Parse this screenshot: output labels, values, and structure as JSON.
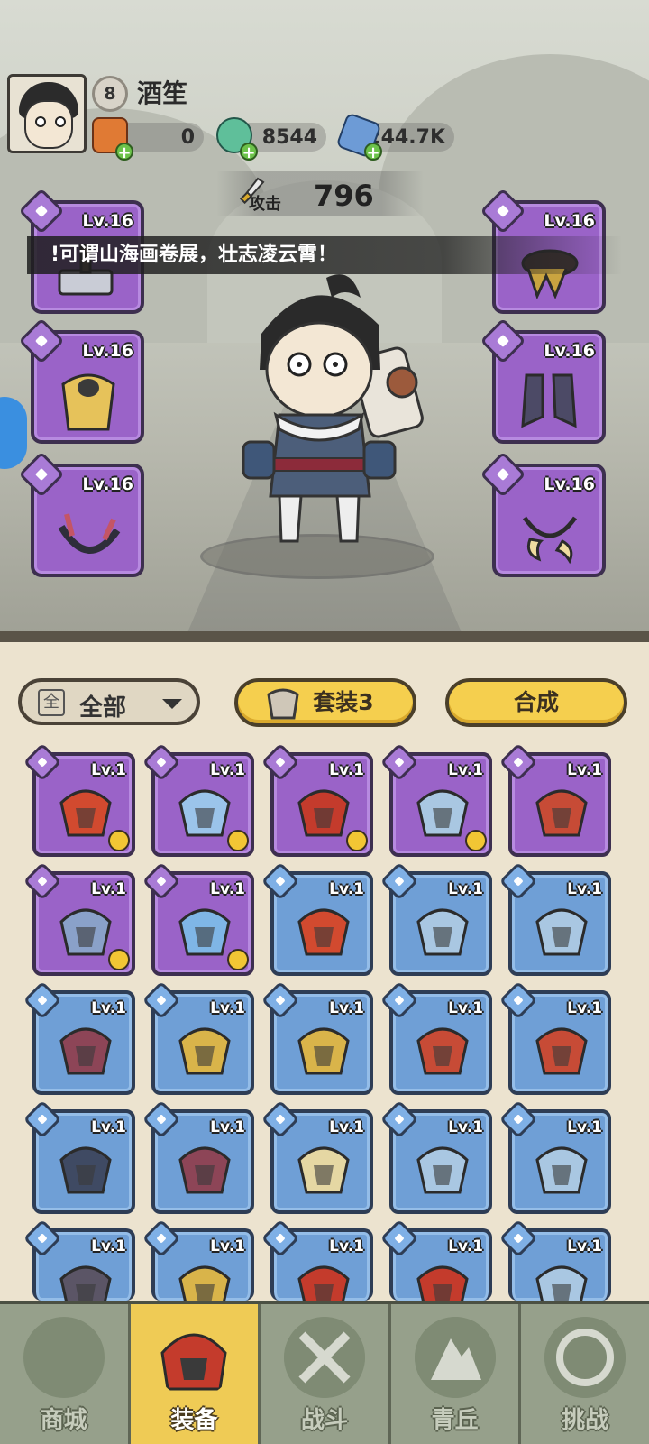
{
  "player": {
    "level": "8",
    "name": "酒笙"
  },
  "resources": [
    {
      "name": "scroll",
      "value": "0"
    },
    {
      "name": "jade",
      "value": "8544"
    },
    {
      "name": "crystal",
      "value": "244.7K"
    }
  ],
  "attack": {
    "label": "攻击",
    "value": "796"
  },
  "banner_text": "!可谓山海画卷展，壮志凌云霄！",
  "equipped": [
    {
      "slot": "weapon",
      "level": "Lv.16"
    },
    {
      "slot": "armor",
      "level": "Lv.16"
    },
    {
      "slot": "necklace",
      "level": "Lv.16"
    },
    {
      "slot": "belt",
      "level": "Lv.16"
    },
    {
      "slot": "boots",
      "level": "Lv.16"
    },
    {
      "slot": "ring",
      "level": "Lv.16"
    }
  ],
  "toolbar": {
    "filter_icon": "全",
    "filter_label": "全部",
    "set_label": "套装3",
    "merge_label": "合成"
  },
  "inventory": [
    {
      "rarity": "purple",
      "level": "Lv.1",
      "badge": true,
      "color": "#d24a2f"
    },
    {
      "rarity": "purple",
      "level": "Lv.1",
      "badge": true,
      "color": "#9bc4ea"
    },
    {
      "rarity": "purple",
      "level": "Lv.1",
      "badge": true,
      "color": "#c43b2c"
    },
    {
      "rarity": "purple",
      "level": "Lv.1",
      "badge": true,
      "color": "#a9c7e2"
    },
    {
      "rarity": "purple",
      "level": "Lv.1",
      "badge": false,
      "color": "#c74b36"
    },
    {
      "rarity": "purple",
      "level": "Lv.1",
      "badge": true,
      "color": "#8aa1c9"
    },
    {
      "rarity": "purple",
      "level": "Lv.1",
      "badge": true,
      "color": "#7fb6e6"
    },
    {
      "rarity": "blue",
      "level": "Lv.1",
      "badge": false,
      "color": "#d24a2f"
    },
    {
      "rarity": "blue",
      "level": "Lv.1",
      "badge": false,
      "color": "#a9c7e2"
    },
    {
      "rarity": "blue",
      "level": "Lv.1",
      "badge": false,
      "color": "#a9c7e2"
    },
    {
      "rarity": "blue",
      "level": "Lv.1",
      "badge": false,
      "color": "#8d4557"
    },
    {
      "rarity": "blue",
      "level": "Lv.1",
      "badge": false,
      "color": "#d9b44a"
    },
    {
      "rarity": "blue",
      "level": "Lv.1",
      "badge": false,
      "color": "#d9b44a"
    },
    {
      "rarity": "blue",
      "level": "Lv.1",
      "badge": false,
      "color": "#c74b36"
    },
    {
      "rarity": "blue",
      "level": "Lv.1",
      "badge": false,
      "color": "#c74b36"
    },
    {
      "rarity": "blue",
      "level": "Lv.1",
      "badge": false,
      "color": "#3f4a63"
    },
    {
      "rarity": "blue",
      "level": "Lv.1",
      "badge": false,
      "color": "#8d4557"
    },
    {
      "rarity": "blue",
      "level": "Lv.1",
      "badge": false,
      "color": "#e5d7a3"
    },
    {
      "rarity": "blue",
      "level": "Lv.1",
      "badge": false,
      "color": "#a9c7e2"
    },
    {
      "rarity": "blue",
      "level": "Lv.1",
      "badge": false,
      "color": "#a9c7e2"
    },
    {
      "rarity": "blue",
      "level": "Lv.1",
      "badge": false,
      "color": "#5b5566"
    },
    {
      "rarity": "blue",
      "level": "Lv.1",
      "badge": false,
      "color": "#d9b44a"
    },
    {
      "rarity": "blue",
      "level": "Lv.1",
      "badge": false,
      "color": "#c43b2c"
    },
    {
      "rarity": "blue",
      "level": "Lv.1",
      "badge": false,
      "color": "#c43b2c"
    },
    {
      "rarity": "blue",
      "level": "Lv.1",
      "badge": false,
      "color": "#a9c7e2"
    }
  ],
  "nav": [
    {
      "label": "商城",
      "icon": "shop-icon",
      "active": false
    },
    {
      "label": "装备",
      "icon": "equipment-icon",
      "active": true
    },
    {
      "label": "战斗",
      "icon": "battle-icon",
      "active": false
    },
    {
      "label": "青丘",
      "icon": "qingqiu-icon",
      "active": false
    },
    {
      "label": "挑战",
      "icon": "challenge-icon",
      "active": false
    }
  ]
}
